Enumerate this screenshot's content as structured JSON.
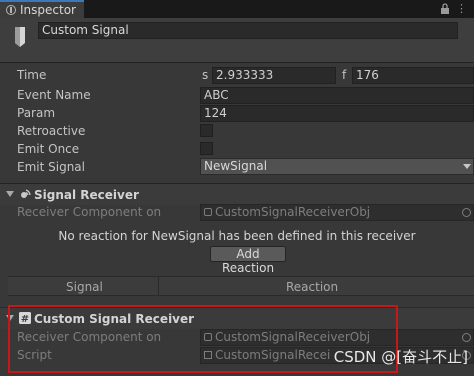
{
  "tab": {
    "label": "Inspector"
  },
  "header": {
    "name": "Custom Signal"
  },
  "props": {
    "time_label": "Time",
    "s_label": "s",
    "seconds": "2.933333",
    "f_label": "f",
    "frames": "176",
    "event_name_label": "Event Name",
    "event_name_value": "ABC",
    "param_label": "Param",
    "param_value": "124",
    "retroactive_label": "Retroactive",
    "emit_once_label": "Emit Once",
    "emit_signal_label": "Emit Signal",
    "emit_signal_value": "NewSignal"
  },
  "signal_receiver": {
    "title": "Signal Receiver",
    "receiver_label": "Receiver Component on",
    "receiver_value": "CustomSignalReceiverObj",
    "message": "No reaction for NewSignal has been defined in this receiver",
    "add_reaction": "Add Reaction",
    "col_signal": "Signal",
    "col_reaction": "Reaction"
  },
  "custom_receiver": {
    "title": "Custom Signal Receiver",
    "receiver_label": "Receiver Component on",
    "receiver_value": "CustomSignalReceiverObj",
    "script_label": "Script",
    "script_value": "CustomSignalRecei"
  },
  "overlay": {
    "watermark": "CSDN @[奋斗不止]"
  },
  "colors": {
    "highlight_box": "#c8171a",
    "tab_accent": "#3a79bb"
  }
}
